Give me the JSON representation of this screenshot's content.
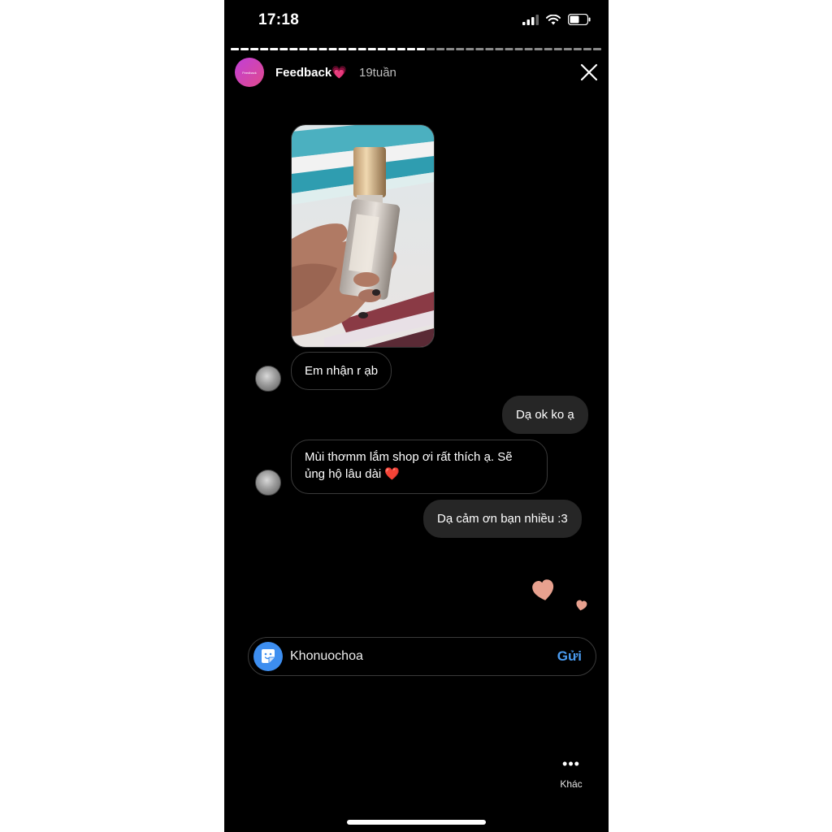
{
  "status_bar": {
    "time": "17:18"
  },
  "story": {
    "avatar_text": "Feedback",
    "title": "Feedback💗",
    "age": "19tuần"
  },
  "messages": [
    {
      "from": "other",
      "text": "Em nhận r ạb"
    },
    {
      "from": "me",
      "text": "Dạ ok ko ạ"
    },
    {
      "from": "other",
      "text": "Mùi thơmm lắm shop ơi rất thích ạ. Sẽ ủng hộ lâu dài ❤️"
    },
    {
      "from": "me",
      "text": "Dạ cảm ơn bạn nhiều :3"
    }
  ],
  "reply": {
    "text": "Khonuochoa",
    "send_label": "Gửi"
  },
  "more": {
    "label": "Khác"
  },
  "colors": {
    "accent_blue": "#3d8ef0",
    "heart": "#e8a18f",
    "avatar_gradient": "#c13fd8"
  }
}
